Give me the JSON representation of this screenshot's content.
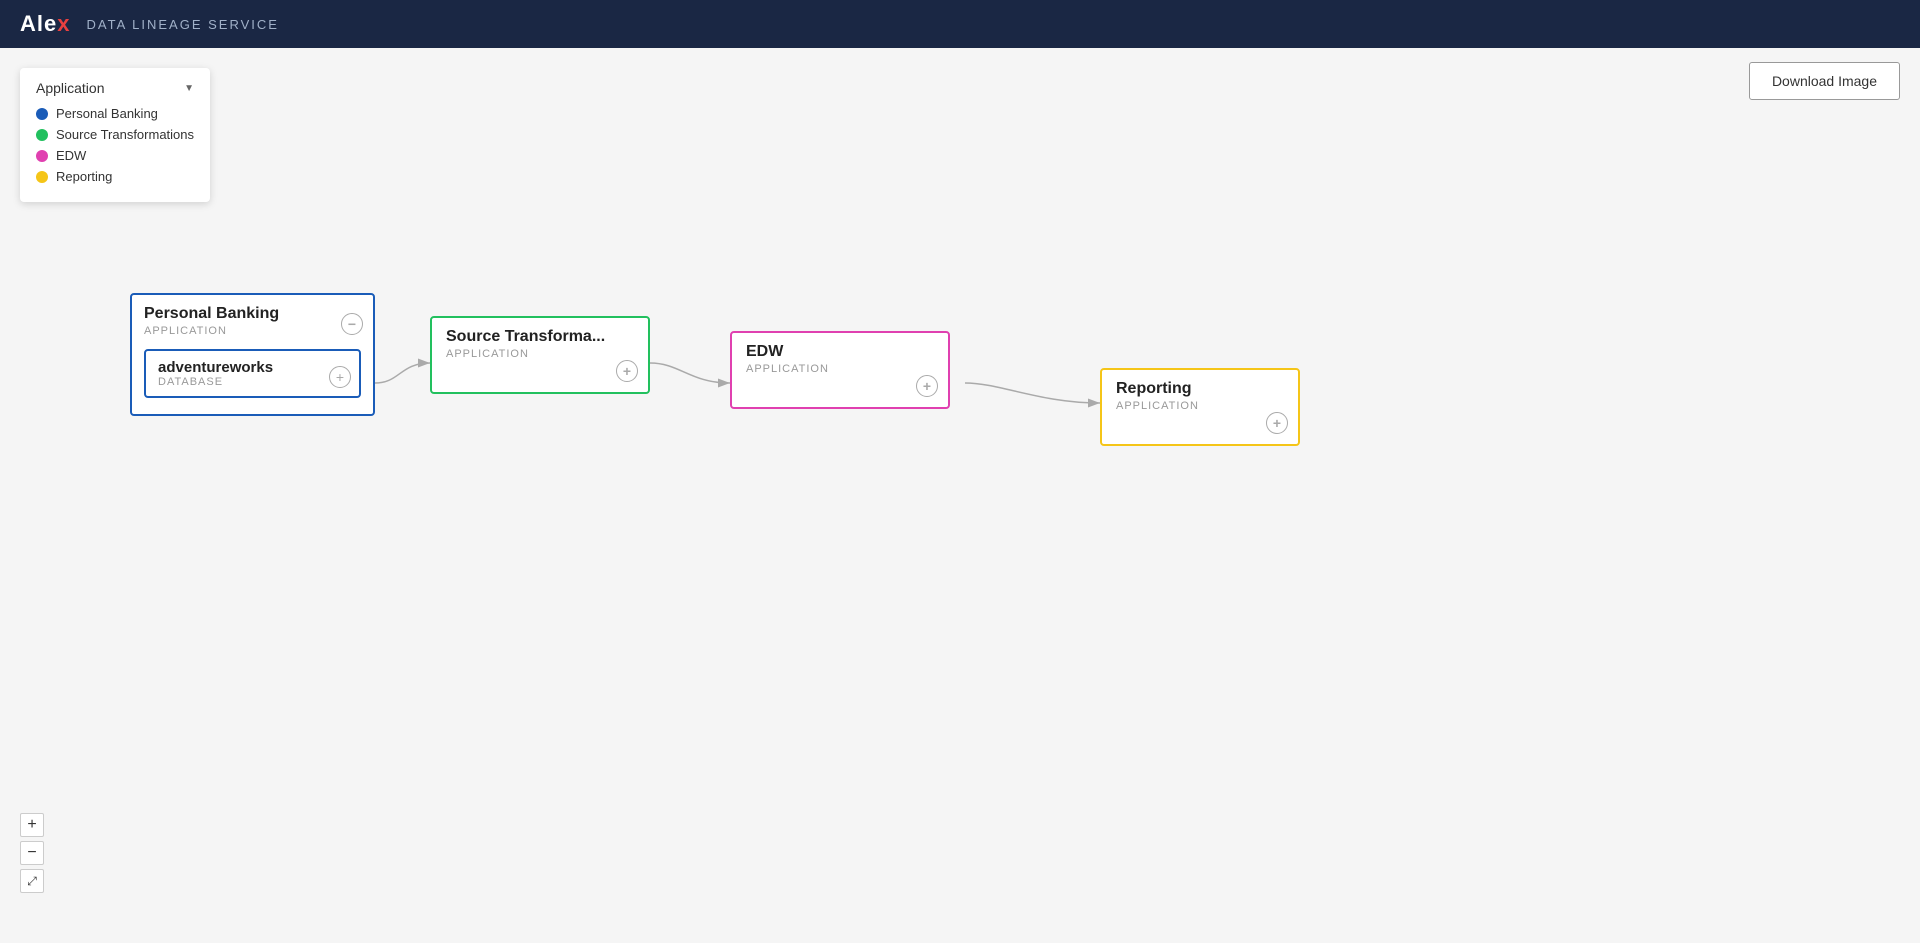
{
  "header": {
    "logo_main": "Alex",
    "logo_x": "x",
    "title": "DATA LINEAGE SERVICE"
  },
  "legend": {
    "dropdown_label": "Application",
    "items": [
      {
        "label": "Personal Banking",
        "color": "#1a5cb8"
      },
      {
        "label": "Source Transformations",
        "color": "#22c05e"
      },
      {
        "label": "EDW",
        "color": "#e040b0"
      },
      {
        "label": "Reporting",
        "color": "#f5c518"
      }
    ]
  },
  "download_button": "Download Image",
  "nodes": {
    "personal_banking": {
      "title": "Personal Banking",
      "subtitle": "APPLICATION",
      "color": "#1a5cb8",
      "inner": {
        "title": "adventureworks",
        "subtitle": "DATABASE"
      }
    },
    "source_transformations": {
      "title": "Source Transforma...",
      "subtitle": "APPLICATION",
      "color": "#22c05e"
    },
    "edw": {
      "title": "EDW",
      "subtitle": "APPLICATION",
      "color": "#e040b0"
    },
    "reporting": {
      "title": "Reporting",
      "subtitle": "APPLICATION",
      "color": "#f5c518"
    }
  },
  "zoom_controls": {
    "zoom_in": "+",
    "zoom_out": "−",
    "fit": "⤢"
  }
}
